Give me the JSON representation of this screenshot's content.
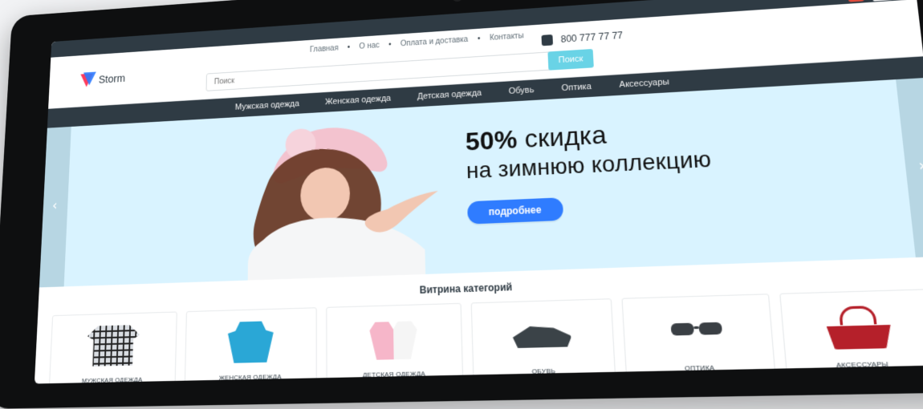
{
  "brand": {
    "name": "Storm"
  },
  "top_links": [
    "Главная",
    "О нас",
    "Оплата и доставка",
    "Контакты"
  ],
  "search": {
    "placeholder": "Поиск",
    "button": "Поиск"
  },
  "phone": {
    "number": "800 777 77 77",
    "icon": "phone-icon"
  },
  "header_right": {
    "badge_count": "0",
    "cart_icon": "cart-icon"
  },
  "category_nav": [
    "Мужская одежда",
    "Женская одежда",
    "Детская одежда",
    "Обувь",
    "Оптика",
    "Аксессуары"
  ],
  "hero": {
    "headline_bold": "50%",
    "headline_rest": "скидка",
    "subline": "на зимнюю коллекцию",
    "cta": "подробнее",
    "left_arrow_icon": "chevron-left-icon",
    "right_arrow_icon": "chevron-right-icon",
    "colors": {
      "bg": "#d9f3ff",
      "cta": "#2f7cff"
    }
  },
  "categories_section": {
    "title": "Витрина категорий",
    "items": [
      {
        "label": "МУЖСКАЯ ОДЕЖДА",
        "icon": "shirt-icon"
      },
      {
        "label": "ЖЕНСКАЯ ОДЕЖДА",
        "icon": "dress-icon"
      },
      {
        "label": "ДЕТСКАЯ ОДЕЖДА",
        "icon": "kids-clothes-icon"
      },
      {
        "label": "ОБУВЬ",
        "icon": "shoe-icon"
      },
      {
        "label": "ОПТИКА",
        "icon": "glasses-icon"
      },
      {
        "label": "АКСЕССУАРЫ",
        "icon": "bag-icon"
      }
    ]
  }
}
